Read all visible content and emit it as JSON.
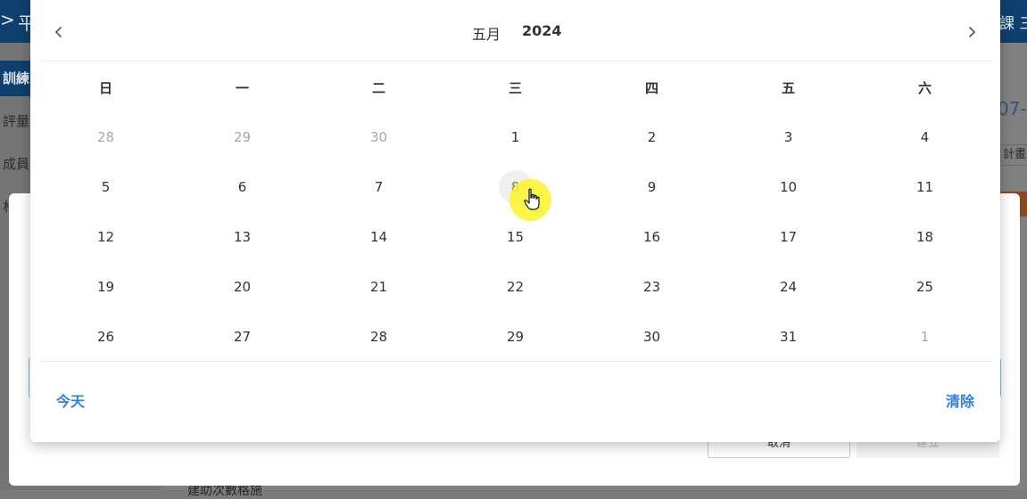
{
  "app": {
    "title": "平",
    "course_fragment": "課 三",
    "sidebar": [
      {
        "label": "訓練",
        "active": true
      },
      {
        "label": "評量",
        "active": false
      },
      {
        "label": "成員",
        "active": false
      },
      {
        "label": "材",
        "active": false
      }
    ],
    "date_fragment": "07-",
    "plan_fragment": "計畫內",
    "bottom_fragment": "建助次數格施"
  },
  "dialog": {
    "cancel_label": "取消",
    "create_label": "建立"
  },
  "datepicker": {
    "month": "五月",
    "year": "2024",
    "weekdays": [
      "日",
      "一",
      "二",
      "三",
      "四",
      "五",
      "六"
    ],
    "weeks": [
      [
        {
          "d": "28",
          "muted": true
        },
        {
          "d": "29",
          "muted": true
        },
        {
          "d": "30",
          "muted": true
        },
        {
          "d": "1"
        },
        {
          "d": "2"
        },
        {
          "d": "3"
        },
        {
          "d": "4"
        }
      ],
      [
        {
          "d": "5"
        },
        {
          "d": "6"
        },
        {
          "d": "7"
        },
        {
          "d": "8",
          "hover": true
        },
        {
          "d": "9"
        },
        {
          "d": "10"
        },
        {
          "d": "11"
        }
      ],
      [
        {
          "d": "12"
        },
        {
          "d": "13"
        },
        {
          "d": "14"
        },
        {
          "d": "15"
        },
        {
          "d": "16"
        },
        {
          "d": "17"
        },
        {
          "d": "18"
        }
      ],
      [
        {
          "d": "19"
        },
        {
          "d": "20"
        },
        {
          "d": "21"
        },
        {
          "d": "22"
        },
        {
          "d": "23"
        },
        {
          "d": "24"
        },
        {
          "d": "25"
        }
      ],
      [
        {
          "d": "26"
        },
        {
          "d": "27"
        },
        {
          "d": "28"
        },
        {
          "d": "29"
        },
        {
          "d": "30"
        },
        {
          "d": "31"
        },
        {
          "d": "1",
          "muted": true
        }
      ]
    ],
    "today_label": "今天",
    "clear_label": "清除",
    "accent_color": "#2f7fdb"
  }
}
